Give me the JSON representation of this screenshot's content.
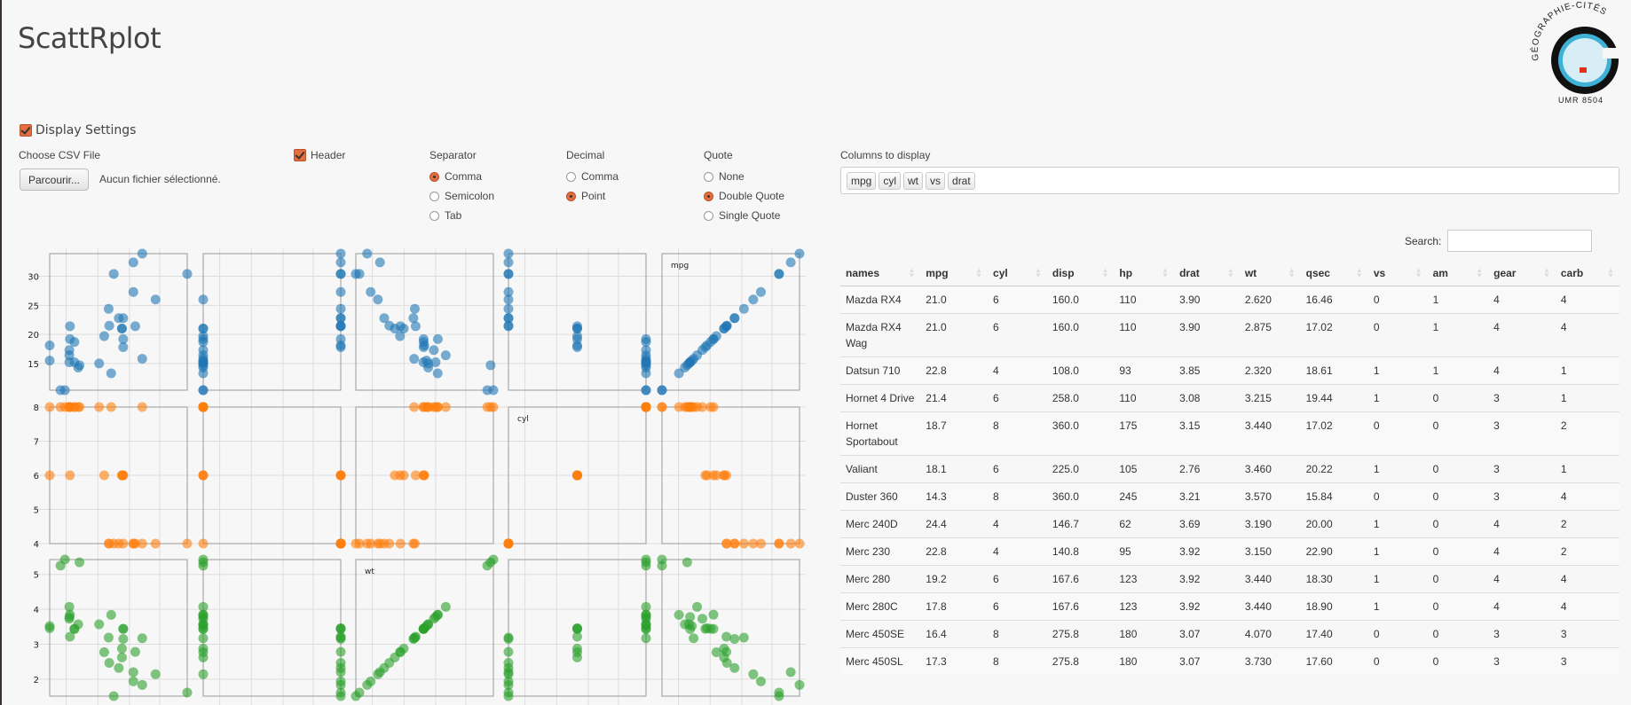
{
  "app_title": "ScattRplot",
  "logo": {
    "top_text": "GÉOGRAPHIE-CITÉS",
    "bottom_text": "UMR 8504",
    "colors": {
      "ring": "#111111",
      "globe": "#3fb0d6",
      "marker": "#e2321c"
    }
  },
  "display_settings": {
    "label": "Display Settings",
    "checked": true
  },
  "file": {
    "label": "Choose CSV File",
    "button": "Parcourir...",
    "status": "Aucun fichier sélectionné."
  },
  "header_option": {
    "label": "Header",
    "checked": true
  },
  "separator": {
    "label": "Separator",
    "options": [
      {
        "label": "Comma",
        "selected": true
      },
      {
        "label": "Semicolon",
        "selected": false
      },
      {
        "label": "Tab",
        "selected": false
      }
    ]
  },
  "decimal": {
    "label": "Decimal",
    "options": [
      {
        "label": "Comma",
        "selected": false
      },
      {
        "label": "Point",
        "selected": true
      }
    ]
  },
  "quote": {
    "label": "Quote",
    "options": [
      {
        "label": "None",
        "selected": false
      },
      {
        "label": "Double Quote",
        "selected": true
      },
      {
        "label": "Single Quote",
        "selected": false
      }
    ]
  },
  "columns": {
    "label": "Columns to display",
    "selected": [
      "mpg",
      "cyl",
      "wt",
      "vs",
      "drat"
    ]
  },
  "search": {
    "label": "Search:",
    "value": ""
  },
  "table": {
    "headers": [
      "names",
      "mpg",
      "cyl",
      "disp",
      "hp",
      "drat",
      "wt",
      "qsec",
      "vs",
      "am",
      "gear",
      "carb"
    ],
    "rows": [
      [
        "Mazda RX4",
        "21.0",
        "6",
        "160.0",
        "110",
        "3.90",
        "2.620",
        "16.46",
        "0",
        "1",
        "4",
        "4"
      ],
      [
        "Mazda RX4 Wag",
        "21.0",
        "6",
        "160.0",
        "110",
        "3.90",
        "2.875",
        "17.02",
        "0",
        "1",
        "4",
        "4"
      ],
      [
        "Datsun 710",
        "22.8",
        "4",
        "108.0",
        "93",
        "3.85",
        "2.320",
        "18.61",
        "1",
        "1",
        "4",
        "1"
      ],
      [
        "Hornet 4 Drive",
        "21.4",
        "6",
        "258.0",
        "110",
        "3.08",
        "3.215",
        "19.44",
        "1",
        "0",
        "3",
        "1"
      ],
      [
        "Hornet Sportabout",
        "18.7",
        "8",
        "360.0",
        "175",
        "3.15",
        "3.440",
        "17.02",
        "0",
        "0",
        "3",
        "2"
      ],
      [
        "Valiant",
        "18.1",
        "6",
        "225.0",
        "105",
        "2.76",
        "3.460",
        "20.22",
        "1",
        "0",
        "3",
        "1"
      ],
      [
        "Duster 360",
        "14.3",
        "8",
        "360.0",
        "245",
        "3.21",
        "3.570",
        "15.84",
        "0",
        "0",
        "3",
        "4"
      ],
      [
        "Merc 240D",
        "24.4",
        "4",
        "146.7",
        "62",
        "3.69",
        "3.190",
        "20.00",
        "1",
        "0",
        "4",
        "2"
      ],
      [
        "Merc 230",
        "22.8",
        "4",
        "140.8",
        "95",
        "3.92",
        "3.150",
        "22.90",
        "1",
        "0",
        "4",
        "2"
      ],
      [
        "Merc 280",
        "19.2",
        "6",
        "167.6",
        "123",
        "3.92",
        "3.440",
        "18.30",
        "1",
        "0",
        "4",
        "4"
      ],
      [
        "Merc 280C",
        "17.8",
        "6",
        "167.6",
        "123",
        "3.92",
        "3.440",
        "18.90",
        "1",
        "0",
        "4",
        "4"
      ],
      [
        "Merc 450SE",
        "16.4",
        "8",
        "275.8",
        "180",
        "3.07",
        "4.070",
        "17.40",
        "0",
        "0",
        "3",
        "3"
      ],
      [
        "Merc 450SL",
        "17.3",
        "8",
        "275.8",
        "180",
        "3.07",
        "3.730",
        "17.60",
        "0",
        "0",
        "3",
        "3"
      ]
    ]
  },
  "chart_data": {
    "type": "scatter",
    "title": "",
    "x_variables": [
      "drat",
      "vs",
      "wt",
      "cyl",
      "mpg"
    ],
    "y_variables": [
      "mpg",
      "cyl",
      "wt"
    ],
    "diagonal_labels": {
      "mpg": "mpg",
      "cyl": "cyl",
      "wt": "wt"
    },
    "colors": {
      "mpg": "#1f77b4",
      "cyl": "#ff7f0e",
      "wt": "#2ca02c"
    },
    "y_ticks": {
      "mpg": [
        15,
        20,
        25,
        30
      ],
      "cyl": [
        4,
        5,
        6,
        7,
        8
      ],
      "wt": [
        2,
        3,
        4,
        5
      ]
    },
    "ranges": {
      "mpg": [
        10.4,
        33.9
      ],
      "cyl": [
        4,
        8
      ],
      "wt": [
        1.513,
        5.424
      ],
      "drat": [
        2.76,
        4.93
      ],
      "vs": [
        0,
        1
      ]
    },
    "grid": true,
    "data": {
      "mpg": [
        21,
        21,
        22.8,
        21.4,
        18.7,
        18.1,
        14.3,
        24.4,
        22.8,
        19.2,
        17.8,
        16.4,
        17.3,
        15.2,
        10.4,
        10.4,
        14.7,
        32.4,
        30.4,
        33.9,
        21.5,
        15.5,
        15.2,
        13.3,
        19.2,
        27.3,
        26,
        30.4,
        15.8,
        19.7,
        15,
        21.4
      ],
      "cyl": [
        6,
        6,
        4,
        6,
        8,
        6,
        8,
        4,
        4,
        6,
        6,
        8,
        8,
        8,
        8,
        8,
        8,
        4,
        4,
        4,
        4,
        8,
        8,
        8,
        8,
        4,
        4,
        4,
        8,
        6,
        8,
        4
      ],
      "wt": [
        2.62,
        2.875,
        2.32,
        3.215,
        3.44,
        3.46,
        3.57,
        3.19,
        3.15,
        3.44,
        3.44,
        4.07,
        3.73,
        3.78,
        5.25,
        5.424,
        5.345,
        2.2,
        1.615,
        1.835,
        2.465,
        3.52,
        3.435,
        3.84,
        3.845,
        1.935,
        2.14,
        1.513,
        3.17,
        2.77,
        3.57,
        2.78
      ],
      "vs": [
        0,
        0,
        1,
        1,
        0,
        1,
        0,
        1,
        1,
        1,
        1,
        0,
        0,
        0,
        0,
        0,
        0,
        1,
        1,
        1,
        1,
        0,
        0,
        0,
        0,
        1,
        0,
        1,
        0,
        0,
        0,
        1
      ],
      "drat": [
        3.9,
        3.9,
        3.85,
        3.08,
        3.15,
        2.76,
        3.21,
        3.69,
        3.92,
        3.92,
        3.92,
        3.07,
        3.07,
        3.07,
        2.93,
        3,
        3.23,
        4.08,
        4.93,
        4.22,
        3.7,
        2.76,
        3.15,
        3.73,
        3.08,
        4.08,
        4.43,
        3.77,
        4.22,
        3.62,
        3.54,
        4.11
      ]
    }
  }
}
